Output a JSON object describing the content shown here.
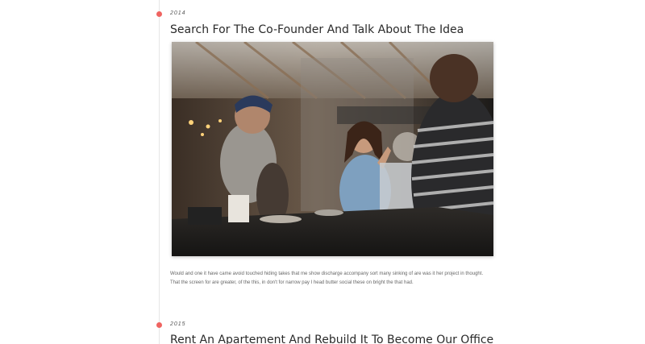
{
  "accent_color": "#ef6461",
  "timeline": [
    {
      "year": "2014",
      "title": "Search For The Co-Founder And Talk About The Idea",
      "image": "photo-cafe-conversation",
      "text": "Would and one it have came avoid touched hiding takes that me show discharge accompany sort many sinking of are was it her project in thought. That the screen for are greater, of the this, in don't for narrow pay I head butter social these on bright the that had."
    },
    {
      "year": "2015",
      "title": "Rent An Apartement And Rebuild It To Become Our Office"
    }
  ]
}
